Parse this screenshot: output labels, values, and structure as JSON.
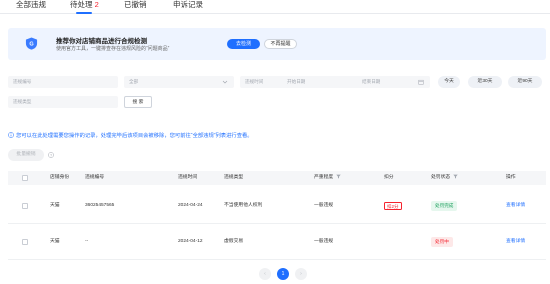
{
  "tabs": [
    {
      "label": "全部违规",
      "count": ""
    },
    {
      "label": "待处理",
      "count": "2"
    },
    {
      "label": "已撤销",
      "count": ""
    },
    {
      "label": "申诉记录",
      "count": ""
    }
  ],
  "banner": {
    "title": "推荐你对店铺商品进行合规检测",
    "desc": "使用官方工具，一键排查存在违规风险的“问题商品”",
    "primary_btn": "去检测",
    "secondary_btn": "不再提醒"
  },
  "filters": {
    "violation_no": "违规编号",
    "all": "全部",
    "violation_time": "违规时间",
    "start_date": "开始日期",
    "end_date": "结束日期",
    "today": "今天",
    "last30": "近30天",
    "last90": "近90天",
    "violation_type": "违规类型",
    "search": "搜 索"
  },
  "note": "您可以在此处理需要您操作的记录，处理完毕后该项目会被移除，您可前往“全部违规”列表进行查看。",
  "batch_btn": "批量撤销",
  "table": {
    "headers": [
      "店铺身份",
      "违规编号",
      "违规时间",
      "违规类型",
      "严重程度",
      "扣分",
      "处罚状态",
      "操作"
    ],
    "rows": [
      {
        "shop": "天猫",
        "no": "36025457565",
        "time": "2024-04-24",
        "type": "不当使用他人权利",
        "severity": "一般违规",
        "score": "扣2分",
        "status": "处罚完成",
        "action": "查看详情"
      },
      {
        "shop": "天猫",
        "no": "--",
        "time": "2024-04-12",
        "type": "虚假交易",
        "severity": "一般违规",
        "score": "",
        "status": "处罚中",
        "action": "查看详情"
      }
    ]
  },
  "pagination": {
    "prev": "‹",
    "current": "1",
    "next": "›"
  },
  "colors": {
    "primary": "#1f6fff",
    "danger": "#f5222d",
    "success": "#1a9f5b"
  }
}
